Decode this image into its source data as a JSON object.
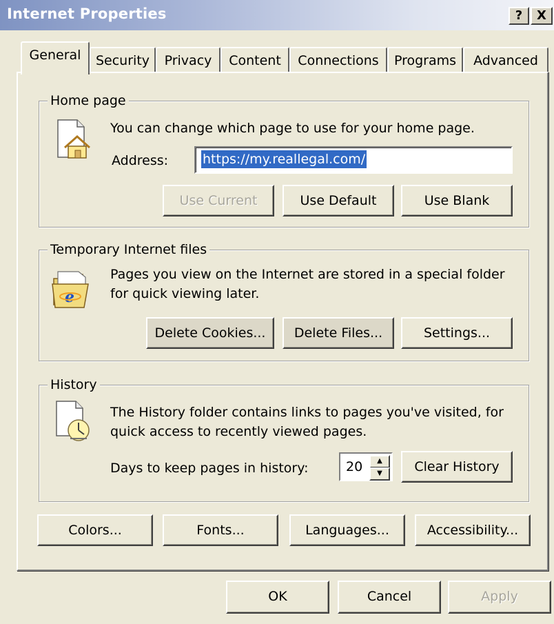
{
  "window": {
    "title": "Internet Properties",
    "help_button": "?",
    "close_button": "X"
  },
  "tabs": [
    {
      "label": "General",
      "active": true
    },
    {
      "label": "Security",
      "active": false
    },
    {
      "label": "Privacy",
      "active": false
    },
    {
      "label": "Content",
      "active": false
    },
    {
      "label": "Connections",
      "active": false
    },
    {
      "label": "Programs",
      "active": false
    },
    {
      "label": "Advanced",
      "active": false
    }
  ],
  "home_page": {
    "legend": "Home page",
    "description": "You can change which page to use for your home page.",
    "address_label": "Address:",
    "address_value": "https://my.reallegal.com/",
    "use_current": "Use Current",
    "use_default": "Use Default",
    "use_blank": "Use Blank"
  },
  "temp_files": {
    "legend": "Temporary Internet files",
    "description_line1": "Pages you view on the Internet are stored in a special folder",
    "description_line2": "for quick viewing later.",
    "delete_cookies": "Delete Cookies...",
    "delete_files": "Delete Files...",
    "settings": "Settings..."
  },
  "history": {
    "legend": "History",
    "description_line1": "The History folder contains links to pages you've visited, for",
    "description_line2": "quick access to recently viewed pages.",
    "days_label": "Days to keep pages in history:",
    "days_value": "20",
    "clear_history": "Clear History"
  },
  "bottom_buttons": {
    "colors": "Colors...",
    "fonts": "Fonts...",
    "languages": "Languages...",
    "accessibility": "Accessibility..."
  },
  "dialog_buttons": {
    "ok": "OK",
    "cancel": "Cancel",
    "apply": "Apply"
  },
  "colors": {
    "face": "#ece9d8",
    "selection": "#316ac5",
    "disabled_text": "#a8a69c"
  }
}
